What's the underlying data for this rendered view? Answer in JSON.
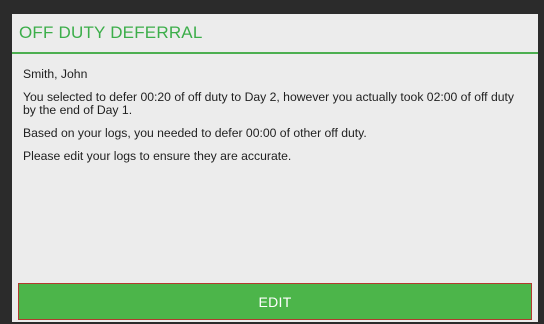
{
  "dialog": {
    "title": "OFF DUTY DEFERRAL",
    "driver_name": "Smith, John",
    "message_1": "You selected to defer 00:20 of off duty to Day 2, however you actually took 02:00 of off duty by the end of Day 1.",
    "message_2": "Based on your logs, you needed to defer 00:00 of other off duty.",
    "message_3": "Please edit your logs to ensure they are accurate.",
    "edit_label": "EDIT"
  },
  "colors": {
    "accent": "#3cae4a",
    "button": "#4cb54a",
    "background": "#2b2b2b",
    "panel": "#ececec"
  }
}
